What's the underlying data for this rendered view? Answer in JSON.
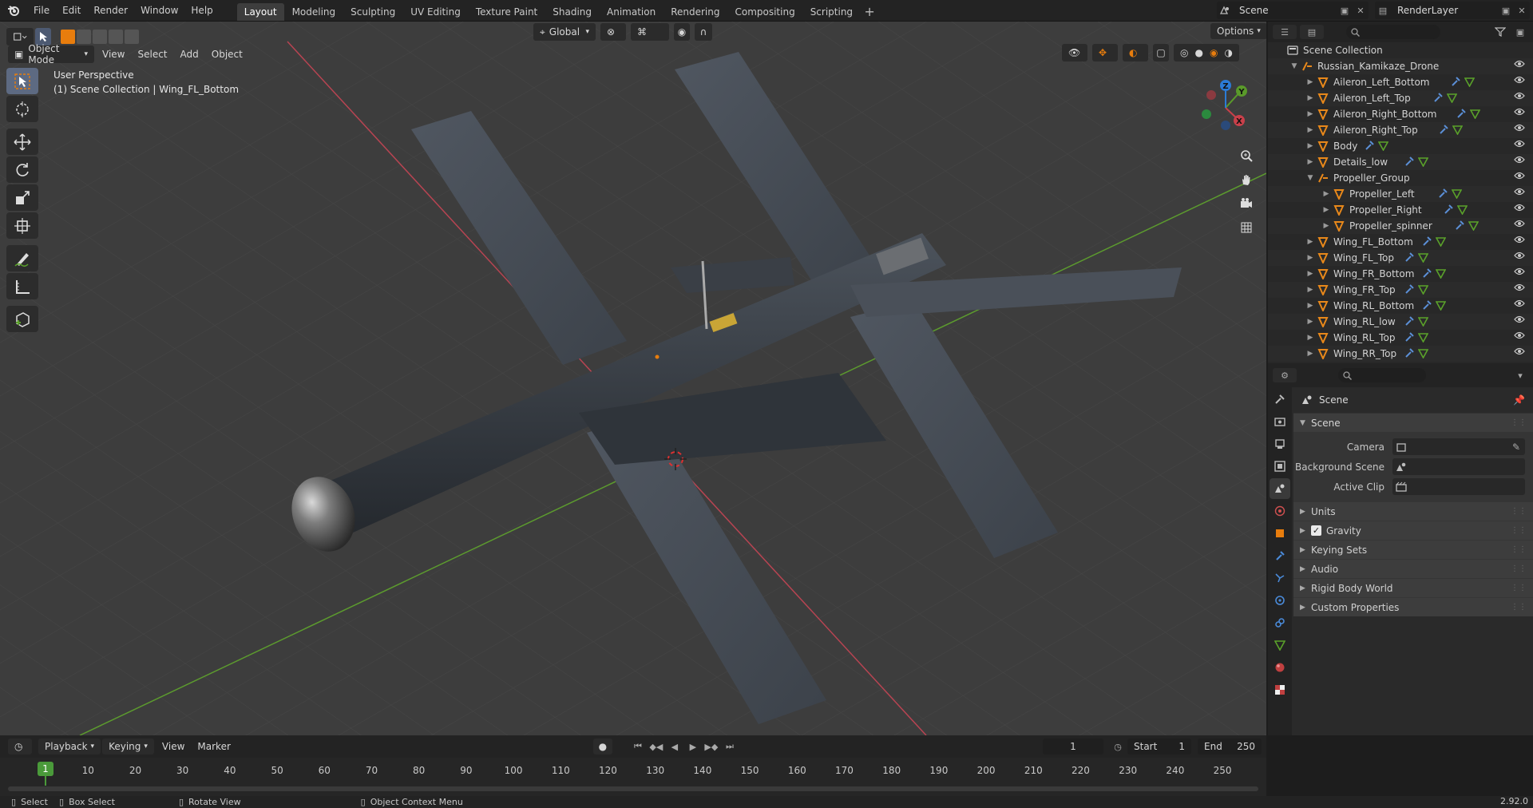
{
  "menus": [
    "File",
    "Edit",
    "Render",
    "Window",
    "Help"
  ],
  "workspace_tabs": [
    {
      "label": "Layout",
      "active": true
    },
    {
      "label": "Modeling"
    },
    {
      "label": "Sculpting"
    },
    {
      "label": "UV Editing"
    },
    {
      "label": "Texture Paint"
    },
    {
      "label": "Shading"
    },
    {
      "label": "Animation"
    },
    {
      "label": "Rendering"
    },
    {
      "label": "Compositing"
    },
    {
      "label": "Scripting"
    }
  ],
  "scene_name": "Scene",
  "render_layer": "RenderLayer",
  "viewport": {
    "mode": "Object Mode",
    "menus": [
      "View",
      "Select",
      "Add",
      "Object"
    ],
    "transform_orientation": "Global",
    "options_label": "Options",
    "perspective": "User Perspective",
    "context": "(1) Scene Collection | Wing_FL_Bottom",
    "gizmo_axes": [
      "X",
      "Y",
      "Z"
    ]
  },
  "outliner": {
    "root": "Scene Collection",
    "object": "Russian_Kamikaze_Drone",
    "items": [
      {
        "name": "Aileron_Left_Bottom",
        "indent": 2
      },
      {
        "name": "Aileron_Left_Top",
        "indent": 2
      },
      {
        "name": "Aileron_Right_Bottom",
        "indent": 2
      },
      {
        "name": "Aileron_Right_Top",
        "indent": 2
      },
      {
        "name": "Body",
        "indent": 2
      },
      {
        "name": "Details_low",
        "indent": 2
      },
      {
        "name": "Propeller_Group",
        "indent": 2,
        "expanded": true,
        "type": "empty"
      },
      {
        "name": "Propeller_Left",
        "indent": 3
      },
      {
        "name": "Propeller_Right",
        "indent": 3
      },
      {
        "name": "Propeller_spinner",
        "indent": 3
      },
      {
        "name": "Wing_FL_Bottom",
        "indent": 2
      },
      {
        "name": "Wing_FL_Top",
        "indent": 2
      },
      {
        "name": "Wing_FR_Bottom",
        "indent": 2
      },
      {
        "name": "Wing_FR_Top",
        "indent": 2
      },
      {
        "name": "Wing_RL_Bottom",
        "indent": 2
      },
      {
        "name": "Wing_RL_low",
        "indent": 2
      },
      {
        "name": "Wing_RL_Top",
        "indent": 2
      },
      {
        "name": "Wing_RR_Top",
        "indent": 2
      }
    ]
  },
  "properties": {
    "context_title": "Scene",
    "panel_title": "Scene",
    "fields": [
      {
        "label": "Camera",
        "icon": "camera-icon"
      },
      {
        "label": "Background Scene",
        "icon": "scene-icon"
      },
      {
        "label": "Active Clip",
        "icon": "clip-icon"
      }
    ],
    "subpanels": [
      {
        "label": "Units"
      },
      {
        "label": "Gravity",
        "checkbox": true,
        "checked": true
      },
      {
        "label": "Keying Sets"
      },
      {
        "label": "Audio"
      },
      {
        "label": "Rigid Body World"
      },
      {
        "label": "Custom Properties"
      }
    ]
  },
  "timeline": {
    "menus": [
      "Playback",
      "Keying",
      "View",
      "Marker"
    ],
    "current_frame": "1",
    "start_label": "Start",
    "start": "1",
    "end_label": "End",
    "end": "250",
    "ruler": [
      "10",
      "20",
      "30",
      "40",
      "50",
      "60",
      "70",
      "80",
      "90",
      "100",
      "110",
      "120",
      "130",
      "140",
      "150",
      "160",
      "170",
      "180",
      "190",
      "200",
      "210",
      "220",
      "230",
      "240",
      "250"
    ],
    "ruler_current": "1"
  },
  "statusbar": {
    "select": "Select",
    "box_select": "Box Select",
    "rotate_view": "Rotate View",
    "context_menu": "Object Context Menu",
    "version": "2.92.0"
  },
  "colors": {
    "accent_orange": "#e87d0d",
    "active_blue": "#5d6a82",
    "axis_red": "#c9404a",
    "axis_green": "#5aa12a",
    "axis_blue": "#2b7bd6",
    "frame_green": "#4a9a3a"
  }
}
